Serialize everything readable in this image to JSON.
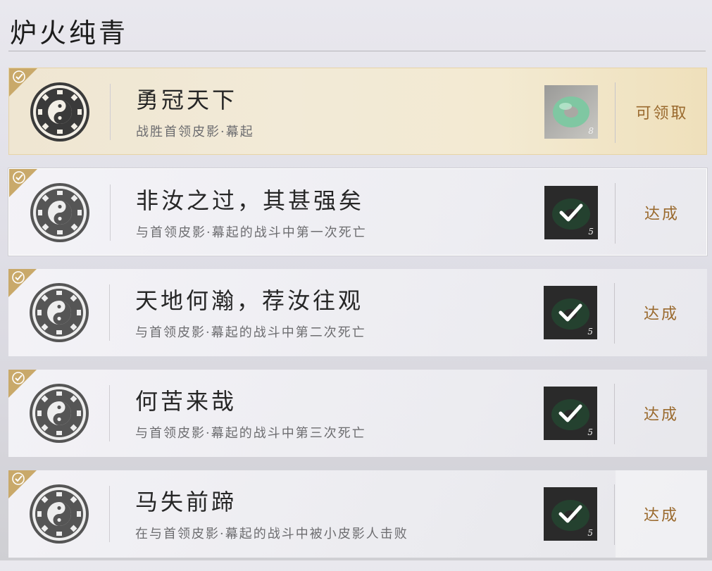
{
  "page": {
    "title": "炉火纯青"
  },
  "colors": {
    "accent_gold": "#c9a96a",
    "status_text": "#9a6a2e",
    "claimable_bg": "#f2ead7"
  },
  "achievements": [
    {
      "name": "勇冠天下",
      "description": "战胜首领皮影·幕起",
      "reward_icon": "jade-pendant-icon",
      "reward_count": "8",
      "status": "可领取",
      "state": "claimable"
    },
    {
      "name": "非汝之过，其甚强矣",
      "description": "与首领皮影·幕起的战斗中第一次死亡",
      "reward_icon": "jade-pendant-icon",
      "reward_count": "5",
      "status": "达成",
      "state": "claimed"
    },
    {
      "name": "天地何瀚，荐汝往观",
      "description": "与首领皮影·幕起的战斗中第二次死亡",
      "reward_icon": "jade-pendant-icon",
      "reward_count": "5",
      "status": "达成",
      "state": "claimed"
    },
    {
      "name": "何苦来哉",
      "description": "与首领皮影·幕起的战斗中第三次死亡",
      "reward_icon": "jade-pendant-icon",
      "reward_count": "5",
      "status": "达成",
      "state": "claimed"
    },
    {
      "name": "马失前蹄",
      "description": "在与首领皮影·幕起的战斗中被小皮影人击败",
      "reward_icon": "jade-pendant-icon",
      "reward_count": "5",
      "status": "达成",
      "state": "claimed"
    }
  ]
}
